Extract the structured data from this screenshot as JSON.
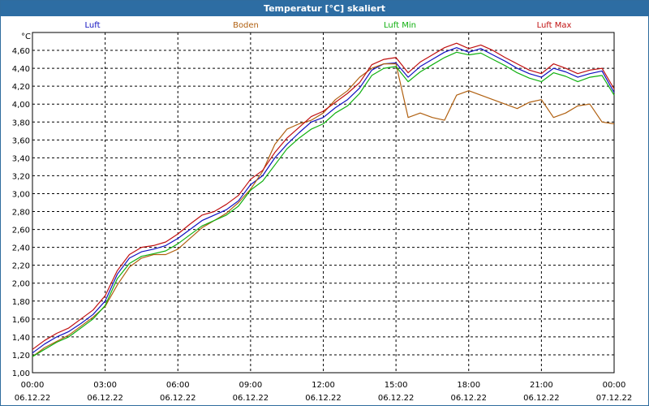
{
  "window": {
    "title": "Temperatur [°C] skaliert"
  },
  "chart_data": {
    "type": "line",
    "title": "Temperatur [°C] skaliert",
    "ylabel": "°C",
    "xlabel": "",
    "ylim": [
      1.0,
      4.8
    ],
    "xlim": [
      0,
      24
    ],
    "grid": true,
    "legend_position": "top",
    "y_ticks": [
      "1,00",
      "1,20",
      "1,40",
      "1,60",
      "1,80",
      "2,00",
      "2,20",
      "2,40",
      "2,60",
      "2,80",
      "3,00",
      "3,20",
      "3,40",
      "3,60",
      "3,80",
      "4,00",
      "4,20",
      "4,40",
      "4,60"
    ],
    "x_ticks": [
      {
        "time": "00:00",
        "date": "06.12.22"
      },
      {
        "time": "03:00",
        "date": "06.12.22"
      },
      {
        "time": "06:00",
        "date": "06.12.22"
      },
      {
        "time": "09:00",
        "date": "06.12.22"
      },
      {
        "time": "12:00",
        "date": "06.12.22"
      },
      {
        "time": "15:00",
        "date": "06.12.22"
      },
      {
        "time": "18:00",
        "date": "06.12.22"
      },
      {
        "time": "21:00",
        "date": "06.12.22"
      },
      {
        "time": "00:00",
        "date": "07.12.22"
      }
    ],
    "x": [
      0,
      0.5,
      1,
      1.5,
      2,
      2.5,
      3,
      3.5,
      4,
      4.5,
      5,
      5.5,
      6,
      6.5,
      7,
      7.5,
      8,
      8.5,
      9,
      9.5,
      10,
      10.5,
      11,
      11.5,
      12,
      12.5,
      13,
      13.5,
      14,
      14.5,
      15,
      15.5,
      16,
      16.5,
      17,
      17.5,
      18,
      18.5,
      19,
      19.5,
      20,
      20.5,
      21,
      21.5,
      22,
      22.5,
      23,
      23.5,
      24
    ],
    "series": [
      {
        "name": "Luft",
        "color": "#1010c0",
        "values": [
          1.22,
          1.32,
          1.4,
          1.46,
          1.55,
          1.65,
          1.8,
          2.1,
          2.28,
          2.35,
          2.38,
          2.42,
          2.5,
          2.6,
          2.7,
          2.76,
          2.82,
          2.92,
          3.1,
          3.2,
          3.4,
          3.55,
          3.68,
          3.8,
          3.85,
          3.96,
          4.05,
          4.18,
          4.38,
          4.45,
          4.46,
          4.3,
          4.42,
          4.5,
          4.58,
          4.63,
          4.58,
          4.62,
          4.55,
          4.48,
          4.4,
          4.34,
          4.3,
          4.4,
          4.36,
          4.3,
          4.34,
          4.37,
          4.13
        ]
      },
      {
        "name": "Boden",
        "color": "#b06010",
        "values": [
          1.18,
          1.28,
          1.35,
          1.42,
          1.52,
          1.62,
          1.74,
          1.98,
          2.18,
          2.28,
          2.32,
          2.32,
          2.38,
          2.5,
          2.62,
          2.7,
          2.78,
          2.9,
          3.05,
          3.25,
          3.55,
          3.72,
          3.78,
          3.82,
          3.9,
          4.05,
          4.15,
          4.3,
          4.4,
          4.45,
          4.45,
          3.85,
          3.9,
          3.85,
          3.82,
          4.1,
          4.15,
          4.1,
          4.05,
          4.0,
          3.95,
          4.02,
          4.05,
          3.85,
          3.9,
          3.98,
          4.0,
          3.8,
          3.78
        ]
      },
      {
        "name": "Luft Min",
        "color": "#10b010",
        "values": [
          1.18,
          1.26,
          1.34,
          1.4,
          1.5,
          1.6,
          1.75,
          2.05,
          2.22,
          2.3,
          2.33,
          2.36,
          2.44,
          2.54,
          2.64,
          2.7,
          2.76,
          2.86,
          3.04,
          3.14,
          3.32,
          3.5,
          3.62,
          3.72,
          3.78,
          3.9,
          3.98,
          4.12,
          4.32,
          4.4,
          4.42,
          4.25,
          4.36,
          4.44,
          4.52,
          4.58,
          4.55,
          4.57,
          4.5,
          4.43,
          4.35,
          4.29,
          4.25,
          4.35,
          4.31,
          4.25,
          4.3,
          4.32,
          4.1
        ]
      },
      {
        "name": "Luft Max",
        "color": "#c01010",
        "values": [
          1.26,
          1.36,
          1.44,
          1.5,
          1.6,
          1.7,
          1.86,
          2.14,
          2.32,
          2.4,
          2.42,
          2.46,
          2.55,
          2.66,
          2.76,
          2.8,
          2.88,
          2.98,
          3.16,
          3.26,
          3.46,
          3.62,
          3.74,
          3.86,
          3.92,
          4.02,
          4.12,
          4.24,
          4.44,
          4.5,
          4.52,
          4.35,
          4.47,
          4.55,
          4.63,
          4.68,
          4.62,
          4.66,
          4.6,
          4.52,
          4.45,
          4.38,
          4.34,
          4.45,
          4.4,
          4.34,
          4.38,
          4.4,
          4.17
        ]
      }
    ]
  }
}
